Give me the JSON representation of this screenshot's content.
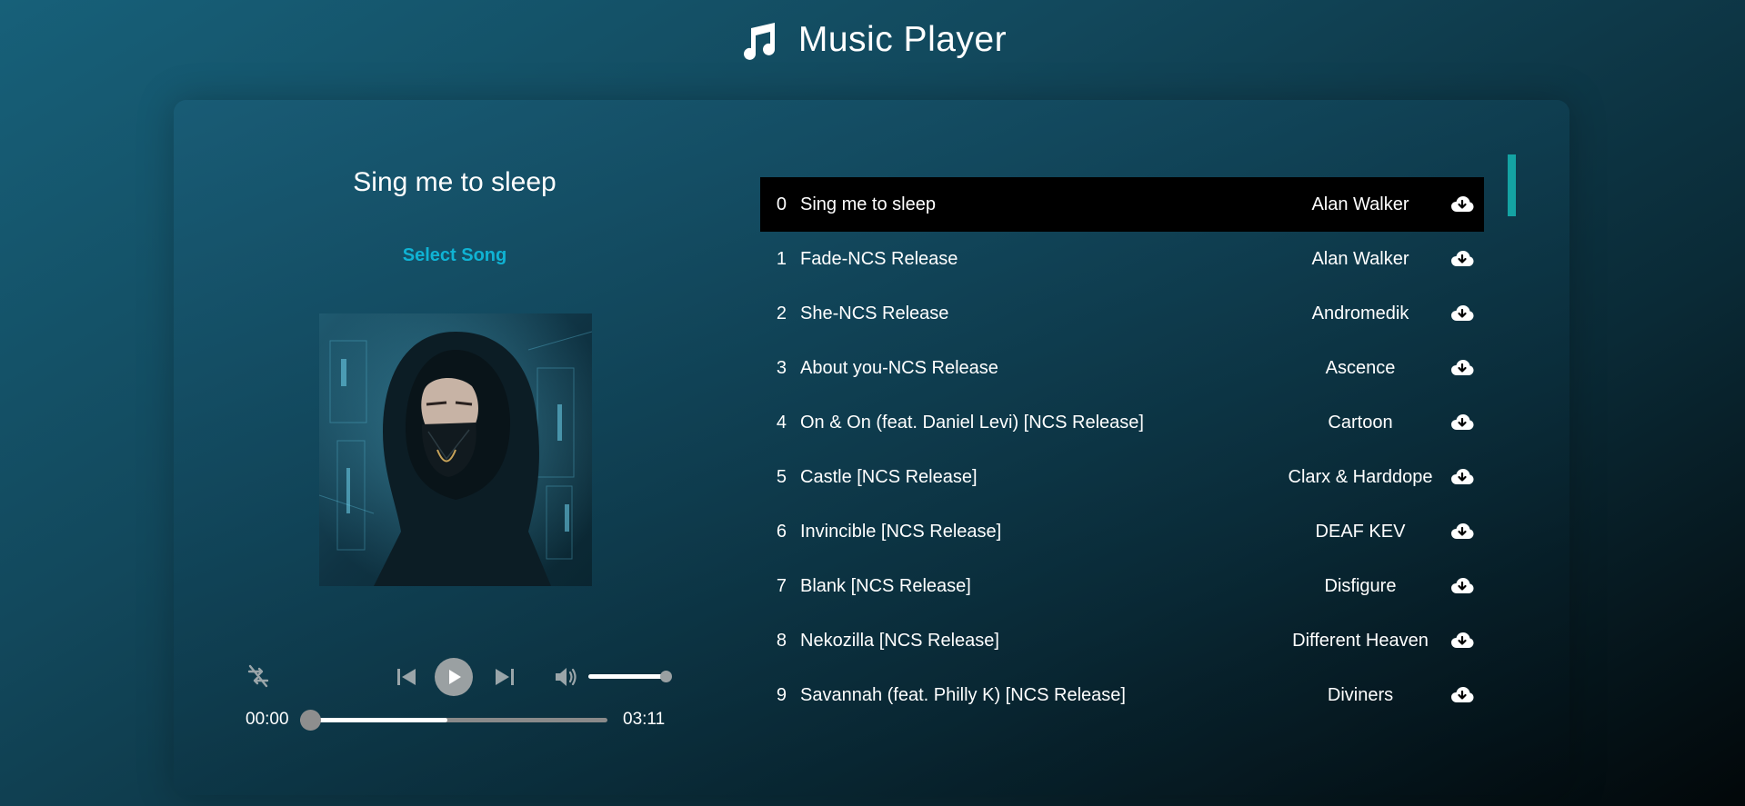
{
  "app": {
    "title": "Music Player"
  },
  "player": {
    "current_title": "Sing me to sleep",
    "select_song_label": "Select Song",
    "time_current": "00:00",
    "time_total": "03:11",
    "progress": 0,
    "buffered": 0.48,
    "volume": 1.0,
    "icons": [
      "shuffle-off-icon",
      "previous-icon",
      "play-icon",
      "next-icon",
      "volume-icon"
    ]
  },
  "playlist": {
    "active_index": 0,
    "download_icon": "cloud-download-icon",
    "songs": [
      {
        "index": "0",
        "title": "Sing me to sleep",
        "artist": "Alan Walker"
      },
      {
        "index": "1",
        "title": "Fade-NCS Release",
        "artist": "Alan Walker"
      },
      {
        "index": "2",
        "title": "She-NCS Release",
        "artist": "Andromedik"
      },
      {
        "index": "3",
        "title": "About you-NCS Release",
        "artist": "Ascence"
      },
      {
        "index": "4",
        "title": "On & On (feat. Daniel Levi) [NCS Release]",
        "artist": "Cartoon"
      },
      {
        "index": "5",
        "title": "Castle [NCS Release]",
        "artist": "Clarx & Harddope"
      },
      {
        "index": "6",
        "title": "Invincible [NCS Release]",
        "artist": "DEAF KEV"
      },
      {
        "index": "7",
        "title": "Blank [NCS Release]",
        "artist": "Disfigure"
      },
      {
        "index": "8",
        "title": "Nekozilla [NCS Release]",
        "artist": "Different Heaven"
      },
      {
        "index": "9",
        "title": "Savannah (feat. Philly K) [NCS Release]",
        "artist": "Diviners"
      }
    ]
  },
  "colors": {
    "accent": "#0fb3d4",
    "scroll_thumb": "#14a3a3",
    "active_row": "#000000"
  }
}
